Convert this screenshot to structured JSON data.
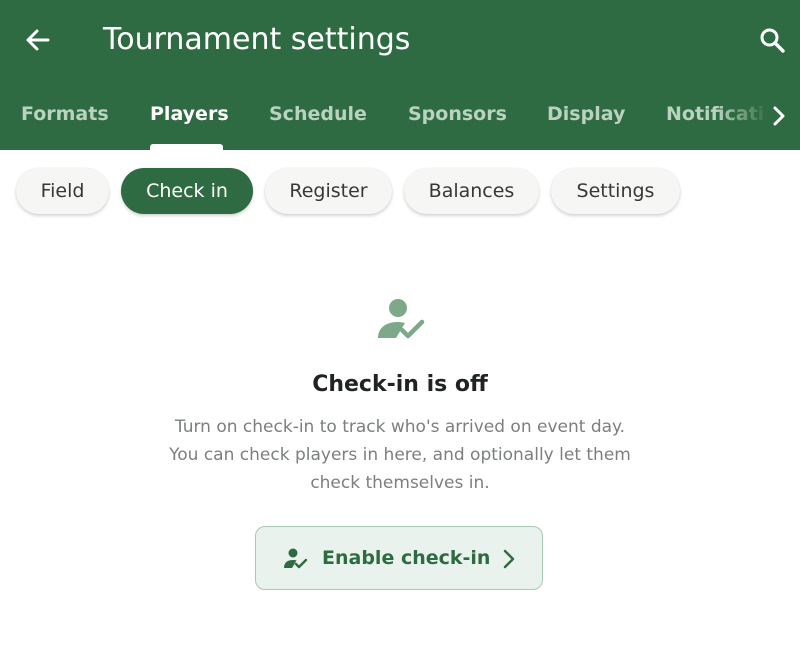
{
  "header": {
    "title": "Tournament settings",
    "back_icon": "arrow-left-icon",
    "search_icon": "search-icon"
  },
  "tabs": [
    {
      "label": "Formats",
      "active": false
    },
    {
      "label": "Players",
      "active": true
    },
    {
      "label": "Schedule",
      "active": false
    },
    {
      "label": "Sponsors",
      "active": false
    },
    {
      "label": "Display",
      "active": false
    },
    {
      "label": "Notificati",
      "active": false
    }
  ],
  "tab_scroll_icon": "chevron-right-icon",
  "chips": [
    {
      "label": "Field",
      "active": false
    },
    {
      "label": "Check in",
      "active": true
    },
    {
      "label": "Register",
      "active": false
    },
    {
      "label": "Balances",
      "active": false
    },
    {
      "label": "Settings",
      "active": false
    }
  ],
  "empty_state": {
    "icon": "person-check-icon",
    "title": "Check-in is off",
    "description_lines": [
      "Turn on check-in to track who's arrived on event day.",
      "You can check players in here, and optionally let them",
      "check themselves in."
    ]
  },
  "enable_button": {
    "label": "Enable check-in",
    "icon": "person-check-icon",
    "trailing_icon": "chevron-right-icon"
  },
  "colors": {
    "primary": "#2f6b42",
    "inactive_tab": "#b9d3c0",
    "chip_background": "#f6f6f4",
    "button_background": "#e9f2ec",
    "icon_muted": "#7ea88a"
  }
}
